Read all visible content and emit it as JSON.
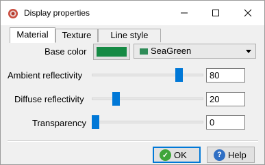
{
  "window": {
    "title": "Display properties",
    "minimize_glyph": "—",
    "close_glyph": "✕"
  },
  "tabs": [
    {
      "label": "Material",
      "active": true
    },
    {
      "label": "Texture",
      "active": false
    },
    {
      "label": "Line style",
      "active": false
    }
  ],
  "base_color": {
    "label": "Base color",
    "swatch_color": "#158a44",
    "selected_name": "SeaGreen",
    "selected_color": "#2e8b57"
  },
  "ambient": {
    "label": "Ambient reflectivity",
    "value": "80",
    "level": 0.8
  },
  "diffuse": {
    "label": "Diffuse reflectivity",
    "value": "20",
    "level": 0.2
  },
  "transparency": {
    "label": "Transparency",
    "value": "0",
    "level": 0.0
  },
  "buttons": {
    "ok_label": "OK",
    "help_label": "Help",
    "ok_icon_glyph": "✓",
    "help_icon_glyph": "?"
  },
  "colors": {
    "accent": "#0078d7",
    "ok_icon": "#3fa53a",
    "help_icon": "#2f6fc4"
  }
}
